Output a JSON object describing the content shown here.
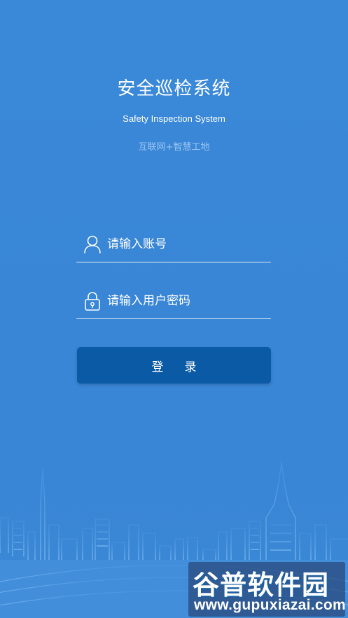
{
  "app": {
    "title": "安全巡检系统",
    "subtitle": "Safety Inspection System",
    "tagline": "互联网+智慧工地"
  },
  "form": {
    "account_placeholder": "请输入账号",
    "account_icon": "user-icon",
    "password_placeholder": "请输入用户密码",
    "password_icon": "lock-icon",
    "login_label": "登录"
  },
  "watermark": {
    "brand": "谷普软件园",
    "url": "www.gupuxiazai.com"
  },
  "colors": {
    "background": "#3a86d6",
    "button": "#0b5aa6",
    "tagline": "#9ec6f2"
  }
}
